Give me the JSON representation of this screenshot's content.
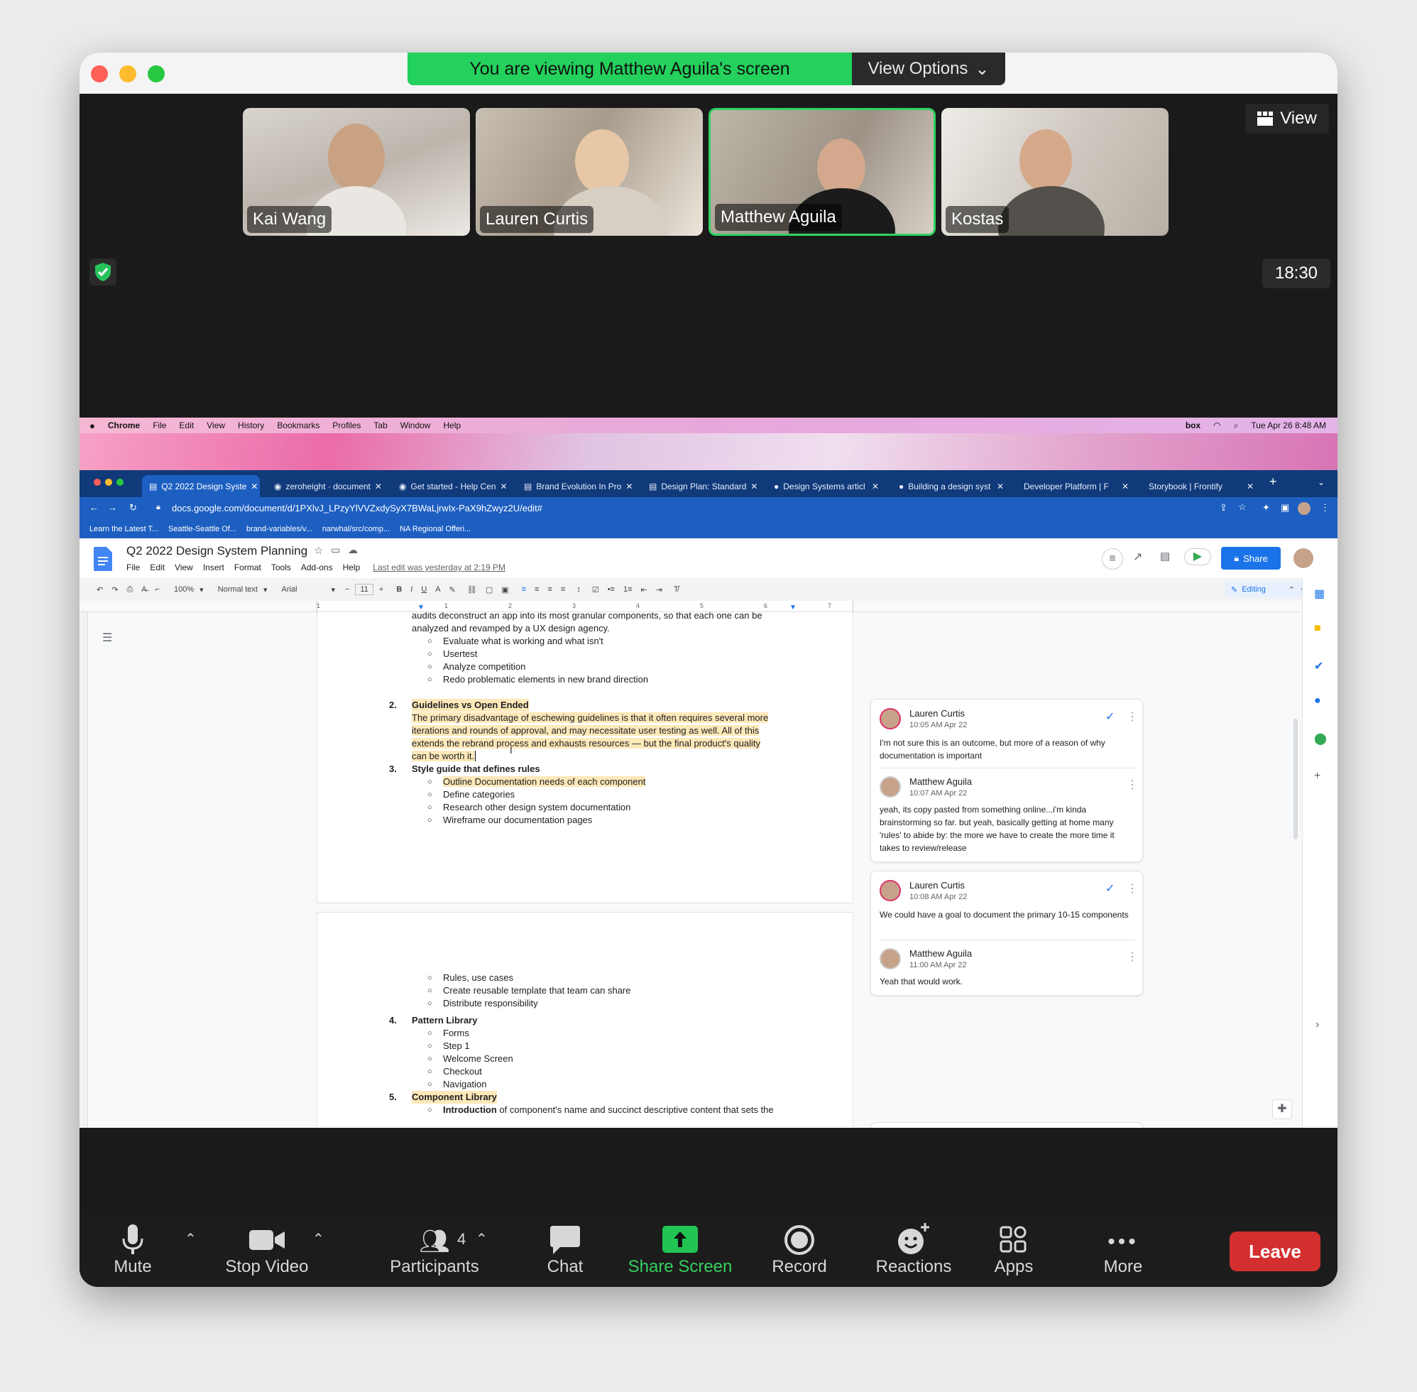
{
  "zoom": {
    "banner": "You are viewing Matthew Aguila's screen",
    "view_options": "View Options",
    "view_button": "View",
    "timer": "18:30",
    "participants": [
      {
        "name": "Kai Wang"
      },
      {
        "name": "Lauren Curtis"
      },
      {
        "name": "Matthew Aguila"
      },
      {
        "name": "Kostas"
      }
    ],
    "controls": {
      "mute": "Mute",
      "stop_video": "Stop Video",
      "participants": "Participants",
      "participants_count": "4",
      "chat": "Chat",
      "share_screen": "Share Screen",
      "record": "Record",
      "reactions": "Reactions",
      "apps": "Apps",
      "more": "More",
      "leave": "Leave"
    }
  },
  "mac_menu": {
    "items": [
      "Chrome",
      "File",
      "Edit",
      "View",
      "History",
      "Bookmarks",
      "Profiles",
      "Tab",
      "Window",
      "Help"
    ],
    "box": "box",
    "clock": "Tue Apr 26  8:48 AM"
  },
  "chrome": {
    "tabs": [
      "Q2 2022 Design Syste",
      "zeroheight · document",
      "Get started - Help Cen",
      "Brand Evolution In Pro",
      "Design Plan: Standard",
      "Design Systems articl",
      "Building a design syst",
      "Developer Platform | F",
      "Storybook | Frontify"
    ],
    "url": "docs.google.com/document/d/1PXlvJ_LPzyYlVVZxdySyX7BWaLjrwIx-PaX9hZwyz2U/edit#",
    "bookmarks": [
      "Learn the Latest T...",
      "Seattle-Seattle Of...",
      "brand-variables/v...",
      "narwhal/src/comp...",
      "NA Regional Offeri..."
    ]
  },
  "docs": {
    "title": "Q2 2022 Design System Planning",
    "menu": [
      "File",
      "Edit",
      "View",
      "Insert",
      "Format",
      "Tools",
      "Add-ons",
      "Help"
    ],
    "last_edit": "Last edit was yesterday at 2:19 PM",
    "share": "Share",
    "toolbar": {
      "zoom": "100%",
      "style": "Normal text",
      "font": "Arial",
      "size": "11",
      "mode": "Editing"
    },
    "ruler": [
      "1",
      "1",
      "2",
      "3",
      "4",
      "5",
      "6",
      "7"
    ],
    "body": {
      "intro1": "audits deconstruct an app into its most granular components, so that each one can be",
      "intro2": "analyzed and revamped by a UX design agency.",
      "list1": [
        "Evaluate what is working and what isn't",
        "Usertest",
        "Analyze competition",
        "Redo problematic elements in new brand direction"
      ],
      "n2": "2.",
      "h2": "Guidelines vs Open Ended",
      "p2": [
        "The primary disadvantage of eschewing guidelines is that it often requires several more",
        "iterations and rounds of approval, and may necessitate user testing as well. All of this",
        "extends the rebrand process and exhausts resources — but the final product's quality",
        "can be worth it."
      ],
      "n3": "3.",
      "h3": "Style guide that defines rules",
      "list3": [
        "Outline Documentation needs of each component",
        "Define categories",
        "Research other design system documentation",
        "Wireframe our documentation pages"
      ],
      "list3b": [
        "Rules, use cases",
        "Create reusable template that team can share",
        "Distribute responsibility"
      ],
      "n4": "4.",
      "h4": "Pattern Library",
      "list4": [
        "Forms",
        "Step 1",
        "Welcome Screen",
        "Checkout",
        "Navigation"
      ],
      "n5": "5.",
      "h5": "Component Library",
      "intro5a": "Introduction",
      "intro5b": " of component's name and succinct descriptive content that sets the"
    },
    "comments": [
      {
        "author": "Lauren Curtis",
        "time": "10:05 AM Apr 22",
        "text": "I'm not sure this is an outcome, but more of a reason of why documentation is important"
      },
      {
        "author": "Matthew Aguila",
        "time": "10:07 AM Apr 22",
        "text": "yeah, its copy pasted from something online...i'm kinda brainstorming so far. but yeah, basically getting at home many 'rules' to abide by: the more we have to create the more time it takes to review/release"
      },
      {
        "author": "Lauren Curtis",
        "time": "10:08 AM Apr 22",
        "text": "We could have a goal to document the primary 10-15 components"
      },
      {
        "author": "Matthew Aguila",
        "time": "11:00 AM Apr 22",
        "text": "Yeah that would work."
      }
    ]
  }
}
